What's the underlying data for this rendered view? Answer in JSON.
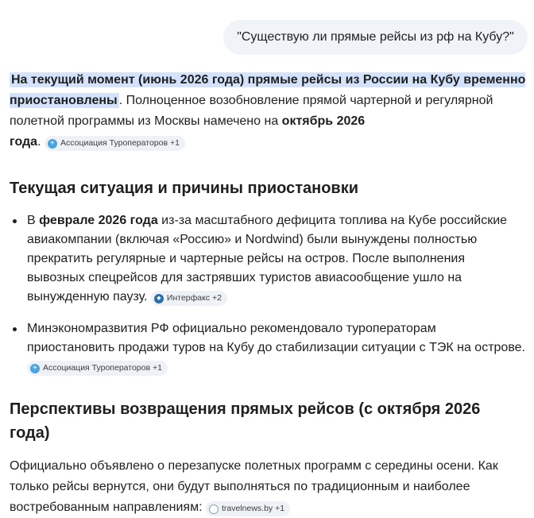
{
  "user_query": "\"Существую ли прямые рейсы из рф на Кубу?\"",
  "intro": {
    "highlight": "На текущий момент (июнь 2026 года) прямые рейсы из России на Кубу временно приостановлены",
    "text1": ". Полноценное возобновление прямой чартерной и регулярной полетной программы из Москвы намечено на ",
    "bold": "октябрь 2026 года",
    "bold_a": "октябрь 2026",
    "bold_b": "года",
    "text2": ".",
    "chip": "Ассоциация Туроператоров +1"
  },
  "section1": {
    "heading": "Текущая ситуация и причины приостановки",
    "items": [
      {
        "pre": "В ",
        "bold": "феврале 2026 года",
        "text": " из-за масштабного дефицита топлива на Кубе российские авиакомпании (включая «Россию» и Nordwind) были вынуждены полностью прекратить регулярные и чартерные рейсы на остров. После выполнения вывозных спецрейсов для застрявших туристов авиасообщение ушло на вынужденную паузу.",
        "chip": "Интерфакс +2"
      },
      {
        "text": "Минэкономразвития РФ официально рекомендовало туроператорам приостановить продажи туров на Кубу до стабилизации ситуации с ТЭК на острове.",
        "chip": "Ассоциация Туроператоров +1"
      }
    ]
  },
  "section2": {
    "heading": "Перспективы возвращения прямых рейсов (с октября 2026 года)",
    "text": "Официально объявлено о перезапуске полетных программ с середины осени. Как только рейсы вернутся, они будут выполняться по традиционным и наиболее востребованным направлениям:",
    "chip": "travelnews.by +1"
  },
  "icons": {
    "ato": "tour-operators-association-icon",
    "interfax": "interfax-icon",
    "travelnews": "travelnews-icon"
  },
  "colors": {
    "highlight": "#d3e3fd",
    "bubble": "#f0f4f9",
    "chip": "#eef1f5"
  }
}
